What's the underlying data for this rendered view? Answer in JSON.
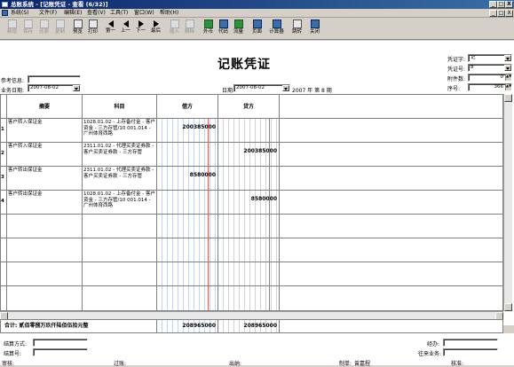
{
  "window": {
    "title": "总账系统 - [记账凭证 - 查看 (6/32)]",
    "controls": [
      "_",
      "□",
      "X"
    ],
    "inner_controls": [
      "_",
      "□",
      "X"
    ]
  },
  "menu": [
    "系统(S)",
    "文件(F)",
    "编辑(E)",
    "查看(V)",
    "工具(T)",
    "窗口(W)",
    "帮助(H)"
  ],
  "toolbar": [
    {
      "label": "新增",
      "icon": "new-icon",
      "enabled": false
    },
    {
      "label": "保存",
      "icon": "save-icon",
      "enabled": false
    },
    {
      "label": "还原",
      "icon": "restore-icon",
      "enabled": false
    },
    {
      "label": "复制",
      "icon": "copy-icon",
      "enabled": false
    },
    {
      "label": "预览",
      "icon": "preview-icon",
      "enabled": true
    },
    {
      "label": "打印",
      "icon": "print-icon",
      "enabled": true
    },
    {
      "label": "第一",
      "icon": "first-icon",
      "enabled": true
    },
    {
      "label": "上一",
      "icon": "prev-icon",
      "enabled": true
    },
    {
      "label": "下一",
      "icon": "next-icon",
      "enabled": true
    },
    {
      "label": "最后",
      "icon": "last-icon",
      "enabled": true
    },
    {
      "label": "插入",
      "icon": "insert-icon",
      "enabled": false
    },
    {
      "label": "删除",
      "icon": "delete-icon",
      "enabled": false
    },
    {
      "label": "外币",
      "icon": "currency-icon",
      "enabled": true
    },
    {
      "label": "代码",
      "icon": "code-icon",
      "enabled": true
    },
    {
      "label": "流量",
      "icon": "flow-icon",
      "enabled": true
    },
    {
      "label": "页面",
      "icon": "page-icon",
      "enabled": true
    },
    {
      "label": "计算器",
      "icon": "calculator-icon",
      "enabled": true
    },
    {
      "label": "跳转",
      "icon": "jump-icon",
      "enabled": true
    },
    {
      "label": "关闭",
      "icon": "close-icon",
      "enabled": true
    }
  ],
  "header": {
    "title": "记账凭证",
    "ref_label": "参考信息:",
    "ref_value": "",
    "bizdate_label": "业务日期:",
    "bizdate_value": "2007-08-02",
    "date_label": "日期:",
    "date_value": "2007-08-02",
    "period_text": "2007 年 第 8 期",
    "voucher_word_label": "凭证字:",
    "voucher_word_value": "记",
    "voucher_no_label": "凭证号:",
    "voucher_no_value": "8",
    "attachments_label": "附件数:",
    "attachments_value": "0",
    "seq_label": "序号:",
    "seq_value": "366"
  },
  "columns": [
    "摘要",
    "科目",
    "借方",
    "贷方"
  ],
  "entries": [
    {
      "num": "1",
      "summary": "客户转入保证金",
      "account": "1028.01.02 - 上存备付金 - 客户资金 - 三方存管/10 001.014 - 广州体育西路",
      "debit": "200385000",
      "credit": ""
    },
    {
      "num": "2",
      "summary": "客户转入保证金",
      "account": "2311.01.02 - 代理买卖证券款 - 客户买卖证券款 - 三方存管",
      "debit": "",
      "credit": "200385000"
    },
    {
      "num": "3",
      "summary": "客户转出保证金",
      "account": "2311.01.02 - 代理买卖证券款 - 客户买卖证券款 - 三方存管",
      "debit": "8580000",
      "credit": ""
    },
    {
      "num": "4",
      "summary": "客户转出保证金",
      "account": "1028.01.02 - 上存备付金 - 客户资金 - 三方存管/10 001.014 - 广州体育西路",
      "debit": "",
      "credit": "8580000"
    }
  ],
  "totals": {
    "label": "合计: 贰佰零捌万玖仟陆佰伍拾元整",
    "debit": "208965000",
    "credit": "208965000"
  },
  "footer": {
    "settle_method_label": "结算方式:",
    "settle_method_value": "",
    "settle_no_label": "结算号:",
    "settle_no_value": "",
    "handler_label": "经办:",
    "handler_value": "",
    "business_label": "往来业务:",
    "business_value": "",
    "audit_label": "审核:",
    "post_label": "过账:",
    "cashier_label": "出纳:",
    "maker_label": "制单:",
    "maker_value": "曾嘉程",
    "approve_label": "核准:"
  }
}
